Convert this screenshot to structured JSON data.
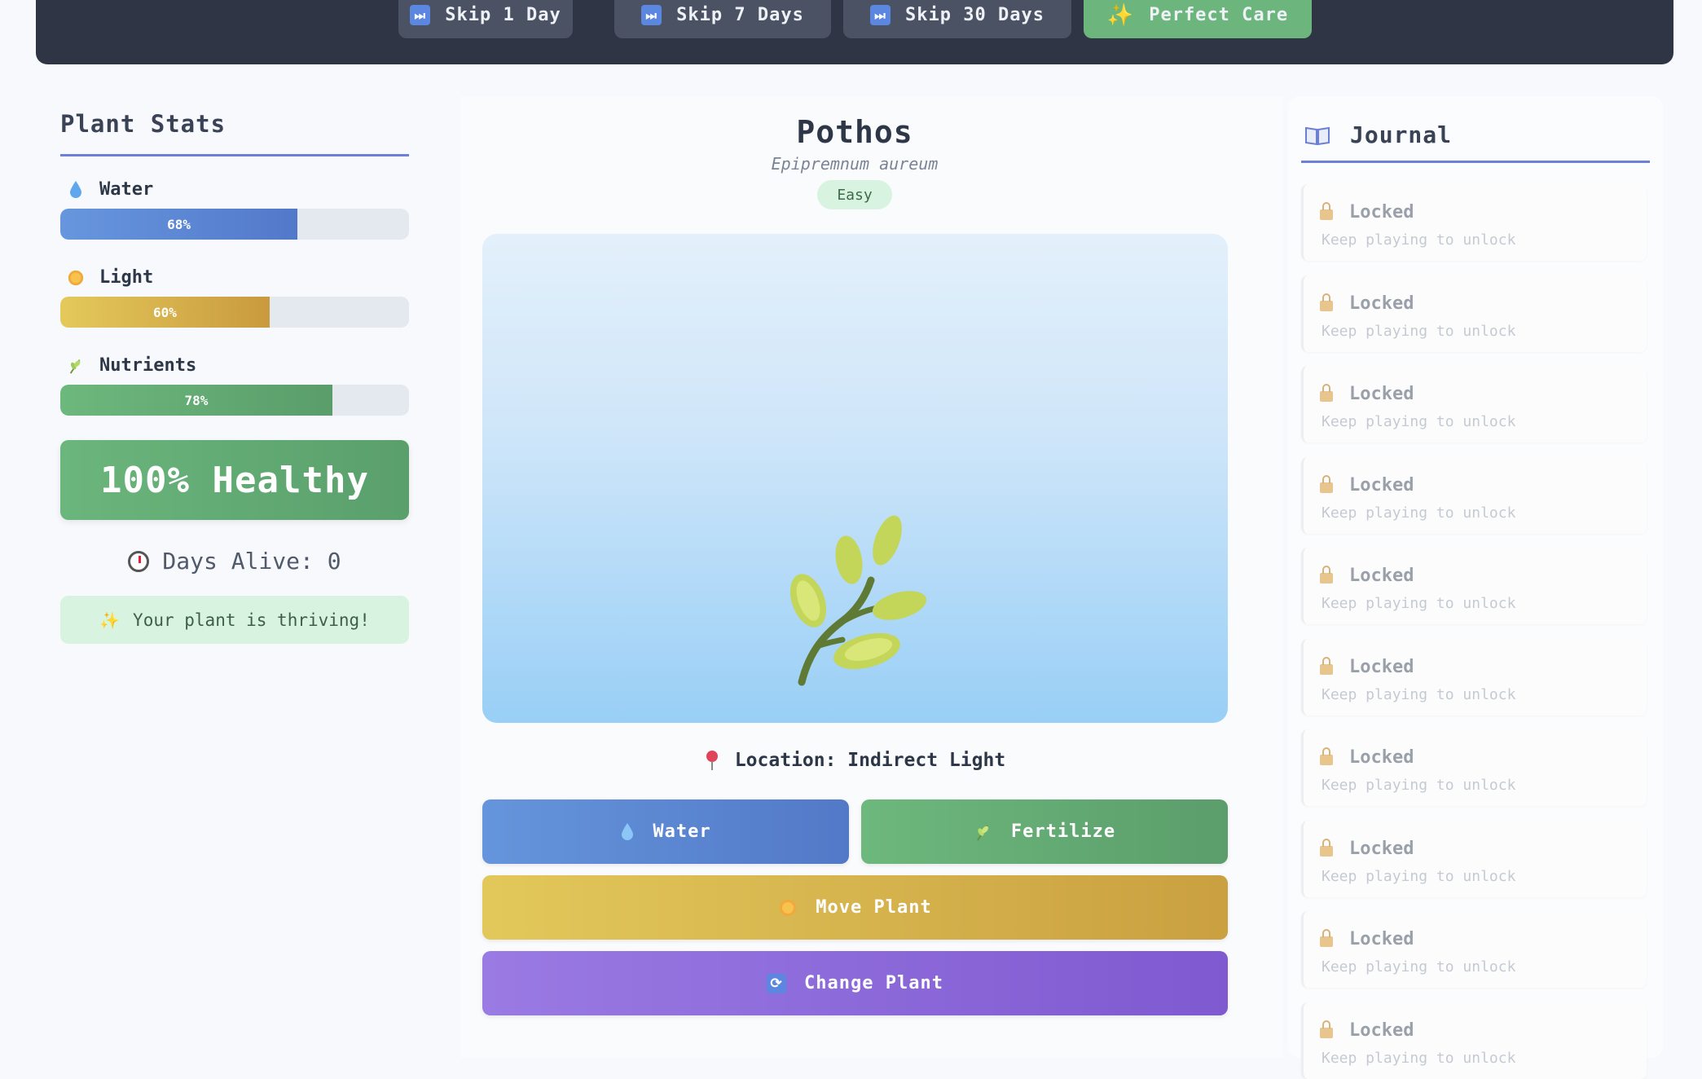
{
  "topbar": {
    "buttons": [
      {
        "label": "Skip 1 Day",
        "icon": "fast-forward-icon"
      },
      {
        "label": "Skip 7 Days",
        "icon": "fast-forward-icon"
      },
      {
        "label": "Skip 30 Days",
        "icon": "fast-forward-icon"
      },
      {
        "label": "Perfect Care",
        "icon": "sparkles-icon"
      }
    ]
  },
  "stats": {
    "title": "Plant Stats",
    "water": {
      "label": "Water",
      "value": 68,
      "text": "68%"
    },
    "light": {
      "label": "Light",
      "value": 60,
      "text": "60%"
    },
    "nutrients": {
      "label": "Nutrients",
      "value": 78,
      "text": "78%"
    },
    "health": "100% Healthy",
    "days_label": "Days Alive: 0",
    "status_message": "Your plant is thriving!"
  },
  "plant": {
    "name": "Pothos",
    "scientific": "Epipremnum aureum",
    "difficulty": "Easy",
    "location": "Location: Indirect Light"
  },
  "actions": {
    "water": "Water",
    "fertilize": "Fertilize",
    "move": "Move Plant",
    "change": "Change Plant"
  },
  "journal": {
    "title": "Journal",
    "entries": [
      {
        "title": "Locked",
        "subtitle": "Keep playing to unlock"
      },
      {
        "title": "Locked",
        "subtitle": "Keep playing to unlock"
      },
      {
        "title": "Locked",
        "subtitle": "Keep playing to unlock"
      },
      {
        "title": "Locked",
        "subtitle": "Keep playing to unlock"
      },
      {
        "title": "Locked",
        "subtitle": "Keep playing to unlock"
      },
      {
        "title": "Locked",
        "subtitle": "Keep playing to unlock"
      },
      {
        "title": "Locked",
        "subtitle": "Keep playing to unlock"
      },
      {
        "title": "Locked",
        "subtitle": "Keep playing to unlock"
      },
      {
        "title": "Locked",
        "subtitle": "Keep playing to unlock"
      },
      {
        "title": "Locked",
        "subtitle": "Keep playing to unlock"
      }
    ]
  }
}
